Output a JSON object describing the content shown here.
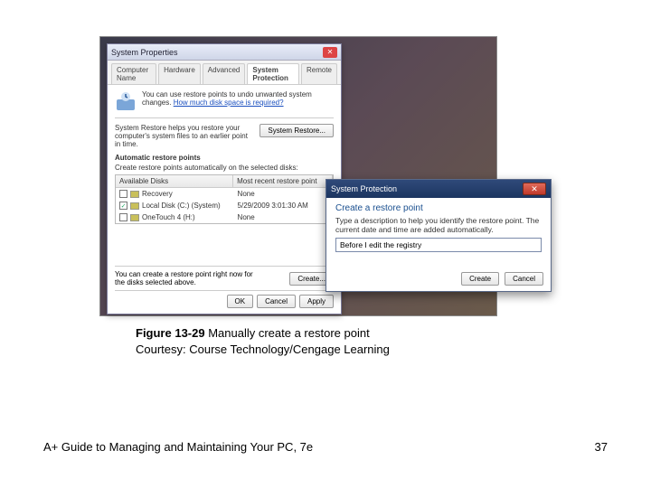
{
  "win1": {
    "title": "System Properties",
    "tabs": [
      "Computer Name",
      "Hardware",
      "Advanced",
      "System Protection",
      "Remote"
    ],
    "active_tab": 3,
    "intro": "You can use restore points to undo unwanted system changes.",
    "intro_link": "How much disk space is required?",
    "restore_desc": "System Restore helps you restore your computer's system files to an earlier point in time.",
    "restore_btn": "System Restore...",
    "auto_head": "Automatic restore points",
    "auto_desc": "Create restore points automatically on the selected disks:",
    "col_a": "Available Disks",
    "col_b": "Most recent restore point",
    "rows": [
      {
        "checked": false,
        "name": "Recovery",
        "when": "None"
      },
      {
        "checked": true,
        "name": "Local Disk (C:) (System)",
        "when": "5/29/2009 3:01:30 AM"
      },
      {
        "checked": false,
        "name": "OneTouch 4 (H:)",
        "when": "None"
      }
    ],
    "create_desc": "You can create a restore point right now for the disks selected above.",
    "create_btn": "Create...",
    "ok": "OK",
    "cancel": "Cancel",
    "apply": "Apply"
  },
  "win2": {
    "title": "System Protection",
    "heading": "Create a restore point",
    "desc": "Type a description to help you identify the restore point. The current date and time are added automatically.",
    "value": "Before I edit the registry",
    "create": "Create",
    "cancel": "Cancel"
  },
  "caption_bold": "Figure 13-29",
  "caption_rest": " Manually create a restore point",
  "courtesy": "Courtesy: Course Technology/Cengage Learning",
  "footer_left": "A+ Guide to Managing and Maintaining Your PC, 7e",
  "footer_right": "37"
}
